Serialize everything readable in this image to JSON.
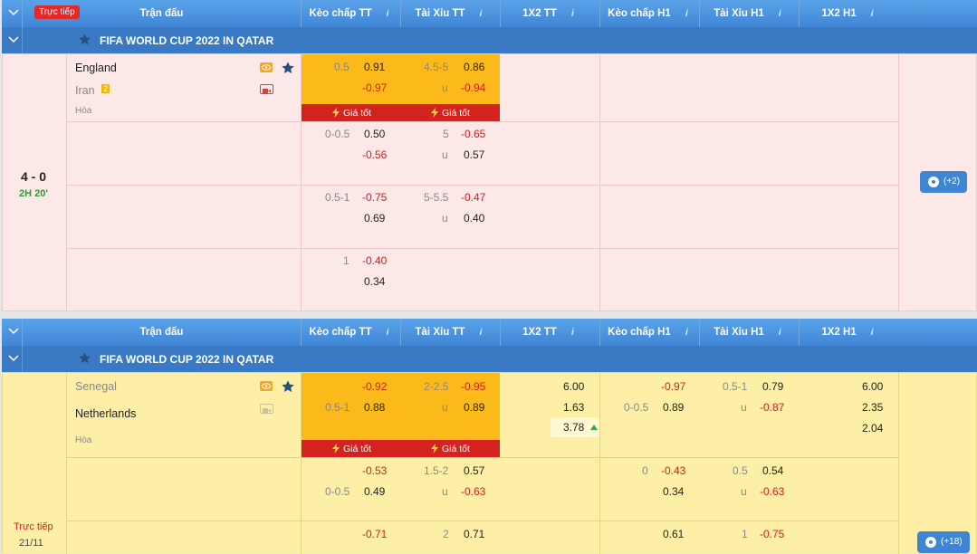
{
  "header": {
    "live_label": "Trực tiếp",
    "columns": [
      "Trận đấu",
      "Kèo chấp TT",
      "Tài Xỉu TT",
      "1X2 TT",
      "Kèo chấp H1",
      "Tài Xỉu H1",
      "1X2 H1"
    ],
    "info_glyph": "i"
  },
  "league": {
    "name": "FIFA WORLD CUP 2022 IN QATAR"
  },
  "match1": {
    "home": "England",
    "away": "Iran",
    "draw": "Hòa",
    "away_badge": "2",
    "score": "4 - 0",
    "time": "2H 20'",
    "best_price": "Giá tốt",
    "more": "(+2)",
    "rows": [
      {
        "hdp": "0.5",
        "hdp_home": "0.91",
        "hdp_away": "-0.97",
        "ou": "4.5-5",
        "ou_over": "0.86",
        "ou_u": "u",
        "ou_under": "-0.94"
      },
      {
        "hdp": "0-0.5",
        "hdp_home": "0.50",
        "hdp_away": "-0.56",
        "ou": "5",
        "ou_over": "-0.65",
        "ou_u": "u",
        "ou_under": "0.57"
      },
      {
        "hdp": "0.5-1",
        "hdp_home": "-0.75",
        "hdp_away": "0.69",
        "ou": "5-5.5",
        "ou_over": "-0.47",
        "ou_u": "u",
        "ou_under": "0.40"
      },
      {
        "hdp": "1",
        "hdp_home": "-0.40",
        "hdp_away": "0.34"
      }
    ]
  },
  "match2": {
    "home": "Senegal",
    "away": "Netherlands",
    "draw": "Hòa",
    "status": "Trực tiếp",
    "date": "21/11",
    "best_price": "Giá tốt",
    "more": "(+18)",
    "row1": {
      "hdp": "0.5-1",
      "hdp_home": "-0.92",
      "hdp_away": "0.88",
      "ou": "2-2.5",
      "ou_over": "-0.95",
      "ou_u": "u",
      "ou_under": "0.89",
      "x12": [
        "6.00",
        "1.63",
        "3.78"
      ],
      "h1_hdp": "0-0.5",
      "h1_hdp_home": "-0.97",
      "h1_hdp_away": "0.89",
      "h1_ou": "0.5-1",
      "h1_ou_over": "0.79",
      "h1_ou_u": "u",
      "h1_ou_under": "-0.87",
      "h1_x12": [
        "6.00",
        "2.35",
        "2.04"
      ]
    },
    "row2": {
      "hdp": "0-0.5",
      "hdp_home": "-0.53",
      "hdp_away": "0.49",
      "ou": "1.5-2",
      "ou_over": "0.57",
      "ou_u": "u",
      "ou_under": "-0.63",
      "h1_hdp": "0",
      "h1_hdp_home": "-0.43",
      "h1_hdp_away": "0.34",
      "h1_ou": "0.5",
      "h1_ou_over": "0.54",
      "h1_ou_u": "u",
      "h1_ou_under": "-0.63"
    },
    "row3": {
      "hdp_home": "-0.71",
      "ou": "2",
      "ou_over": "0.71",
      "h1_hdp_home": "0.61",
      "h1_ou": "1",
      "h1_ou_over": "-0.75"
    }
  },
  "colors": {
    "header": "#4a92df",
    "league": "#3a7ac4",
    "pink": "#fde8e8",
    "yellow": "#fdf0a6",
    "orange": "#fbb91a",
    "red": "#d4231f"
  }
}
